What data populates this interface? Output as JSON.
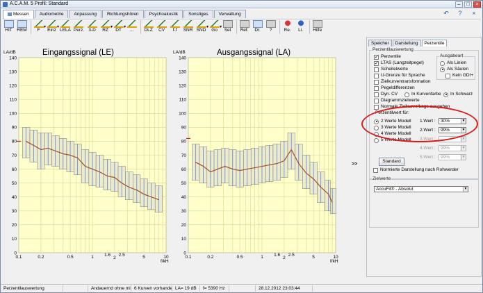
{
  "window": {
    "title": "A.C.A.M. 5  Profil: Standard",
    "buttons": [
      "–",
      "□",
      "×"
    ]
  },
  "main_tabs": [
    {
      "label": "Messen",
      "active": true
    },
    {
      "label": "Audiometrie"
    },
    {
      "label": "Anpassung"
    },
    {
      "label": "Richtungshören"
    },
    {
      "label": "Psychoakustik"
    },
    {
      "label": "Sonstiges"
    },
    {
      "label": "Verwaltung"
    }
  ],
  "nav": {
    "undo": "↶",
    "help": "?",
    "close": "×"
  },
  "toolbar": [
    {
      "label": "HIT",
      "icon": "hit-icon"
    },
    {
      "label": "REM",
      "icon": "rem-icon"
    },
    {
      "label": "F",
      "icon": "curve-icon",
      "dropdown": true
    },
    {
      "label": "Einz",
      "icon": "curve-icon",
      "dropdown": true
    },
    {
      "label": "LELA",
      "icon": "curve-icon"
    },
    {
      "label": "Perz.",
      "icon": "curve-icon"
    },
    {
      "label": "3-D",
      "icon": "curve-icon"
    },
    {
      "label": "RZ",
      "icon": "curve-icon",
      "dropdown": true
    },
    {
      "label": "DT",
      "icon": "curve-icon",
      "dropdown": true
    },
    {
      "label": "...",
      "icon": "curve-icon"
    },
    {
      "label": "DLZ",
      "icon": "curve-icon"
    },
    {
      "label": "CV",
      "icon": "curve-icon"
    },
    {
      "label": "f-f",
      "icon": "curve-icon"
    },
    {
      "label": "SNR",
      "icon": "curve-icon"
    },
    {
      "label": "SND",
      "icon": "curve-icon",
      "dropdown": true
    },
    {
      "label": "Go",
      "icon": "go-icon",
      "dropdown": true
    },
    {
      "label": "Set",
      "icon": "tools-icon"
    },
    {
      "label": "Ref.",
      "icon": "glasses-icon"
    },
    {
      "label": "Dr.",
      "icon": "printer-icon"
    },
    {
      "label": "?",
      "icon": "question-icon"
    },
    {
      "label": "Re.",
      "icon": "right-ear-icon"
    },
    {
      "label": "Li.",
      "icon": "left-ear-icon"
    },
    {
      "label": "Hilfe",
      "icon": "help-icon"
    }
  ],
  "chart_data": [
    {
      "type": "line",
      "title": "Eingangssignal (LE)",
      "ylabel": "LA/dB",
      "xlabel": "f/kHz",
      "xscale": "log",
      "xlim": [
        0.1,
        10
      ],
      "ylim": [
        0,
        140
      ],
      "yticks": [
        0,
        10,
        20,
        30,
        40,
        50,
        60,
        70,
        80,
        90,
        100,
        110,
        120,
        130,
        140
      ],
      "xtick_labels": [
        "0.1",
        "0.2",
        "0.5",
        "1",
        "1.6",
        "2",
        "2.5",
        "5",
        "10"
      ],
      "xtick_values": [
        0.1,
        0.2,
        0.5,
        1,
        1.6,
        2,
        2.5,
        5,
        10
      ],
      "grid": true,
      "marker_y": 80,
      "median": {
        "x": [
          0.125,
          0.16,
          0.2,
          0.25,
          0.315,
          0.4,
          0.5,
          0.63,
          0.8,
          1,
          1.25,
          1.6,
          2,
          2.5,
          3.15,
          4,
          5,
          6.3,
          8
        ],
        "y": [
          80,
          77,
          74,
          75,
          73,
          71,
          70,
          68,
          62,
          60,
          58,
          55,
          54,
          50,
          47,
          45,
          42,
          40,
          38
        ]
      },
      "bands": {
        "x": [
          0.125,
          0.16,
          0.2,
          0.25,
          0.315,
          0.4,
          0.5,
          0.63,
          0.8,
          1,
          1.25,
          1.6,
          2,
          2.5,
          3.15,
          4,
          5,
          6.3,
          8
        ],
        "low": [
          68,
          65,
          60,
          63,
          62,
          60,
          58,
          56,
          50,
          48,
          47,
          45,
          44,
          40,
          38,
          36,
          33,
          31,
          29
        ],
        "high": [
          90,
          88,
          86,
          86,
          84,
          82,
          80,
          78,
          74,
          72,
          70,
          67,
          65,
          62,
          58,
          56,
          53,
          50,
          48
        ]
      }
    },
    {
      "type": "line",
      "title": "Ausgangssignal (LA)",
      "ylabel": "LA/dB",
      "xlabel": "f/kHz",
      "xscale": "log",
      "xlim": [
        0.1,
        10
      ],
      "ylim": [
        0,
        140
      ],
      "yticks": [
        0,
        10,
        20,
        30,
        40,
        50,
        60,
        70,
        80,
        90,
        100,
        110,
        120,
        130,
        140
      ],
      "xtick_labels": [
        "0.1",
        "0.2",
        "0.5",
        "1",
        "1.6",
        "2",
        "2.5",
        "5",
        "10"
      ],
      "xtick_values": [
        0.1,
        0.2,
        0.5,
        1,
        1.6,
        2,
        2.5,
        5,
        10
      ],
      "grid": true,
      "marker_y": 82,
      "median": {
        "x": [
          0.125,
          0.16,
          0.2,
          0.25,
          0.315,
          0.4,
          0.5,
          0.63,
          0.8,
          1,
          1.25,
          1.6,
          2,
          2.5,
          3.15,
          4,
          5,
          6.3,
          8,
          9
        ],
        "y": [
          65,
          62,
          58,
          60,
          62,
          60,
          59,
          60,
          61,
          62,
          63,
          64,
          66,
          74,
          64,
          57,
          53,
          47,
          42,
          36
        ]
      },
      "bands": {
        "x": [
          0.125,
          0.16,
          0.2,
          0.25,
          0.315,
          0.4,
          0.5,
          0.63,
          0.8,
          1,
          1.25,
          1.6,
          2,
          2.5,
          3.15,
          4,
          5,
          6.3,
          8,
          9
        ],
        "low": [
          52,
          50,
          47,
          48,
          50,
          48,
          47,
          48,
          49,
          50,
          51,
          52,
          54,
          60,
          52,
          46,
          42,
          36,
          30,
          28
        ],
        "high": [
          78,
          76,
          73,
          74,
          75,
          74,
          73,
          74,
          75,
          76,
          77,
          78,
          80,
          86,
          78,
          70,
          65,
          58,
          52,
          46
        ]
      }
    }
  ],
  "expand_arrows": ">>",
  "right_panel": {
    "tabs": [
      "Speicher",
      "Darstellung",
      "Perzentile"
    ],
    "active_tab": "Perzentile",
    "group_title": "Perzentilauswertung",
    "checkboxes": [
      {
        "label": "Perzentile",
        "checked": true
      },
      {
        "label": "LTAS (Langzeitpegel)",
        "checked": true
      },
      {
        "label": "Scheitelwerte",
        "checked": false
      },
      {
        "label": "U-Grenze für Sprache",
        "checked": false
      },
      {
        "label": "Zielkurventransformation",
        "checked": false
      },
      {
        "label": "Pegeldifferenzen",
        "checked": false
      },
      {
        "label": "Dyn. CV",
        "checked": false
      },
      {
        "label": "Diagrammzielwerte",
        "checked": false
      },
      {
        "label": "Normale Zielkurve/Lage ausgeben",
        "checked": false
      }
    ],
    "colour_options": [
      {
        "label": "In Kurvenfarbe",
        "selected": false
      },
      {
        "label": "In Schwarz",
        "selected": true
      }
    ],
    "ausgabeart": {
      "title": "Ausgabeart",
      "options": [
        {
          "label": "Als Linien",
          "selected": false
        },
        {
          "label": "Als Säulen",
          "selected": true
        }
      ],
      "kein_gdi": {
        "label": "Kein GDI+",
        "checked": false
      }
    },
    "perz_fuer": "Perzentilwert für:",
    "models": [
      {
        "label": "2 Werte Modell",
        "selected": true
      },
      {
        "label": "3 Werte Modell",
        "selected": false
      },
      {
        "label": "4 Werte Modell",
        "selected": false
      },
      {
        "label": "5 Werte Modell",
        "selected": false
      }
    ],
    "werte": [
      {
        "label": "1.Wert :",
        "value": "30%",
        "enabled": true
      },
      {
        "label": "2.Wert :",
        "value": "99%",
        "enabled": true
      },
      {
        "label": "3.Wert :",
        "value": "",
        "enabled": false
      },
      {
        "label": "4.Wert :",
        "value": "99%",
        "enabled": false
      },
      {
        "label": "5.Wert :",
        "value": "99%",
        "enabled": false
      }
    ],
    "standard_button": "Standard",
    "normiert": {
      "label": "Normierte Darstellung nach Rohwerder",
      "checked": false
    },
    "zielwerte": {
      "title": "Zielwerte",
      "value": "AccuFit® - Absolut"
    }
  },
  "statusbar": [
    "Perzentilauswertung",
    "",
    "Andauernd ohne mitte",
    "6 Kurven vorhanden",
    "LA= 19 dB",
    "f= 5390 Hz",
    "",
    "28.12.2012 23:03:44"
  ],
  "colors": {
    "plot_bg": "#ffffcc",
    "grid": "#d8d890",
    "median": "#a0502a",
    "band_fill": "#e8e8cc",
    "band_stroke": "#7a7a7a",
    "blue_lines": "#3a5fd0",
    "marker": "#cc2222",
    "annotation": "#e01515"
  }
}
